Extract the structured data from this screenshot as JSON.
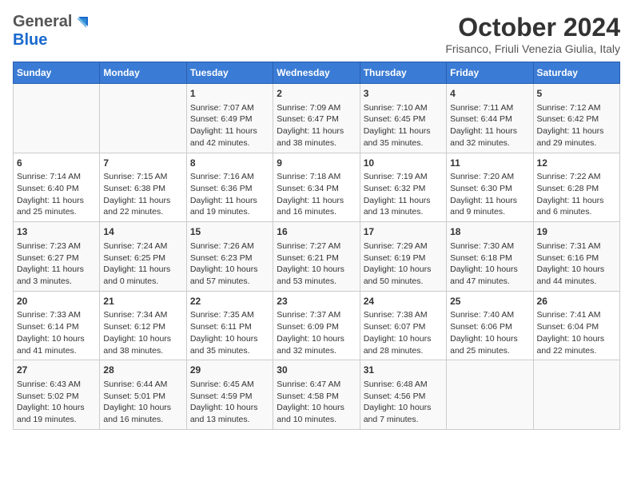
{
  "header": {
    "logo_general": "General",
    "logo_blue": "Blue",
    "month_title": "October 2024",
    "location": "Frisanco, Friuli Venezia Giulia, Italy"
  },
  "days_of_week": [
    "Sunday",
    "Monday",
    "Tuesday",
    "Wednesday",
    "Thursday",
    "Friday",
    "Saturday"
  ],
  "weeks": [
    [
      {
        "day": "",
        "content": ""
      },
      {
        "day": "",
        "content": ""
      },
      {
        "day": "1",
        "content": "Sunrise: 7:07 AM\nSunset: 6:49 PM\nDaylight: 11 hours and 42 minutes."
      },
      {
        "day": "2",
        "content": "Sunrise: 7:09 AM\nSunset: 6:47 PM\nDaylight: 11 hours and 38 minutes."
      },
      {
        "day": "3",
        "content": "Sunrise: 7:10 AM\nSunset: 6:45 PM\nDaylight: 11 hours and 35 minutes."
      },
      {
        "day": "4",
        "content": "Sunrise: 7:11 AM\nSunset: 6:44 PM\nDaylight: 11 hours and 32 minutes."
      },
      {
        "day": "5",
        "content": "Sunrise: 7:12 AM\nSunset: 6:42 PM\nDaylight: 11 hours and 29 minutes."
      }
    ],
    [
      {
        "day": "6",
        "content": "Sunrise: 7:14 AM\nSunset: 6:40 PM\nDaylight: 11 hours and 25 minutes."
      },
      {
        "day": "7",
        "content": "Sunrise: 7:15 AM\nSunset: 6:38 PM\nDaylight: 11 hours and 22 minutes."
      },
      {
        "day": "8",
        "content": "Sunrise: 7:16 AM\nSunset: 6:36 PM\nDaylight: 11 hours and 19 minutes."
      },
      {
        "day": "9",
        "content": "Sunrise: 7:18 AM\nSunset: 6:34 PM\nDaylight: 11 hours and 16 minutes."
      },
      {
        "day": "10",
        "content": "Sunrise: 7:19 AM\nSunset: 6:32 PM\nDaylight: 11 hours and 13 minutes."
      },
      {
        "day": "11",
        "content": "Sunrise: 7:20 AM\nSunset: 6:30 PM\nDaylight: 11 hours and 9 minutes."
      },
      {
        "day": "12",
        "content": "Sunrise: 7:22 AM\nSunset: 6:28 PM\nDaylight: 11 hours and 6 minutes."
      }
    ],
    [
      {
        "day": "13",
        "content": "Sunrise: 7:23 AM\nSunset: 6:27 PM\nDaylight: 11 hours and 3 minutes."
      },
      {
        "day": "14",
        "content": "Sunrise: 7:24 AM\nSunset: 6:25 PM\nDaylight: 11 hours and 0 minutes."
      },
      {
        "day": "15",
        "content": "Sunrise: 7:26 AM\nSunset: 6:23 PM\nDaylight: 10 hours and 57 minutes."
      },
      {
        "day": "16",
        "content": "Sunrise: 7:27 AM\nSunset: 6:21 PM\nDaylight: 10 hours and 53 minutes."
      },
      {
        "day": "17",
        "content": "Sunrise: 7:29 AM\nSunset: 6:19 PM\nDaylight: 10 hours and 50 minutes."
      },
      {
        "day": "18",
        "content": "Sunrise: 7:30 AM\nSunset: 6:18 PM\nDaylight: 10 hours and 47 minutes."
      },
      {
        "day": "19",
        "content": "Sunrise: 7:31 AM\nSunset: 6:16 PM\nDaylight: 10 hours and 44 minutes."
      }
    ],
    [
      {
        "day": "20",
        "content": "Sunrise: 7:33 AM\nSunset: 6:14 PM\nDaylight: 10 hours and 41 minutes."
      },
      {
        "day": "21",
        "content": "Sunrise: 7:34 AM\nSunset: 6:12 PM\nDaylight: 10 hours and 38 minutes."
      },
      {
        "day": "22",
        "content": "Sunrise: 7:35 AM\nSunset: 6:11 PM\nDaylight: 10 hours and 35 minutes."
      },
      {
        "day": "23",
        "content": "Sunrise: 7:37 AM\nSunset: 6:09 PM\nDaylight: 10 hours and 32 minutes."
      },
      {
        "day": "24",
        "content": "Sunrise: 7:38 AM\nSunset: 6:07 PM\nDaylight: 10 hours and 28 minutes."
      },
      {
        "day": "25",
        "content": "Sunrise: 7:40 AM\nSunset: 6:06 PM\nDaylight: 10 hours and 25 minutes."
      },
      {
        "day": "26",
        "content": "Sunrise: 7:41 AM\nSunset: 6:04 PM\nDaylight: 10 hours and 22 minutes."
      }
    ],
    [
      {
        "day": "27",
        "content": "Sunrise: 6:43 AM\nSunset: 5:02 PM\nDaylight: 10 hours and 19 minutes."
      },
      {
        "day": "28",
        "content": "Sunrise: 6:44 AM\nSunset: 5:01 PM\nDaylight: 10 hours and 16 minutes."
      },
      {
        "day": "29",
        "content": "Sunrise: 6:45 AM\nSunset: 4:59 PM\nDaylight: 10 hours and 13 minutes."
      },
      {
        "day": "30",
        "content": "Sunrise: 6:47 AM\nSunset: 4:58 PM\nDaylight: 10 hours and 10 minutes."
      },
      {
        "day": "31",
        "content": "Sunrise: 6:48 AM\nSunset: 4:56 PM\nDaylight: 10 hours and 7 minutes."
      },
      {
        "day": "",
        "content": ""
      },
      {
        "day": "",
        "content": ""
      }
    ]
  ]
}
